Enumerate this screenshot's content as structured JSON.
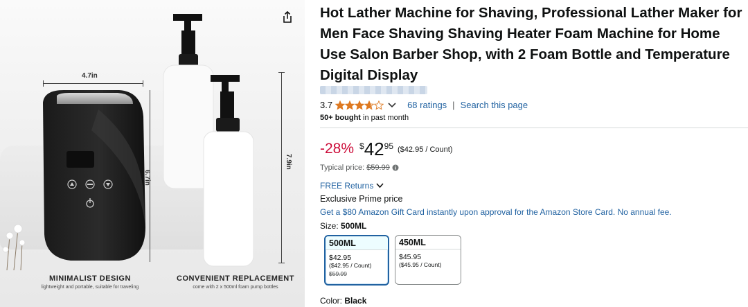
{
  "gallery": {
    "dimensions": {
      "width": "4.7in",
      "height_machine": "6.7in",
      "height_bottle": "7.9in"
    },
    "captions": [
      {
        "title": "MINIMALIST DESIGN",
        "subtitle": "lightweight and portable, suitable for traveling"
      },
      {
        "title": "CONVENIENT REPLACEMENT",
        "subtitle": "come with 2 x 500ml foam pump bottles"
      }
    ],
    "icons": {
      "share": "share-icon"
    }
  },
  "product": {
    "title": "Hot Lather Machine for Shaving, Professional Lather Maker for Men Face Shaving Shaving Heater Foam Machine for Home Use Salon Barber Shop, with 2 Foam Bottle and Temperature Digital Display",
    "rating": "3.7",
    "ratings_count": "68 ratings",
    "search_link": "Search this page",
    "bought_bold": "50+ bought",
    "bought_rest": " in past month",
    "stars_value": 3.7
  },
  "price": {
    "discount": "-28%",
    "currency": "$",
    "whole": "42",
    "fraction": "95",
    "per_unit": "($42.95 / Count)",
    "typical_label": "Typical price:",
    "typical_value": "$59.99"
  },
  "shipping": {
    "returns": "FREE Returns",
    "prime": "Exclusive Prime price",
    "gift_card": "Get a $80 Amazon Gift Card instantly upon approval for the Amazon Store Card. No annual fee."
  },
  "size": {
    "label": "Size: ",
    "selected": "500ML",
    "options": [
      {
        "name": "500ML",
        "price": "$42.95",
        "unit": "($42.95 / Count)",
        "old": "$59.99"
      },
      {
        "name": "450ML",
        "price": "$45.95",
        "unit": "($45.95 / Count)",
        "old": ""
      }
    ]
  },
  "color": {
    "label": "Color: ",
    "selected": "Black"
  },
  "colors": {
    "link": "#2162a1",
    "discount": "#cc0c39",
    "star": "#de7921",
    "selected_border": "#2162a1"
  }
}
